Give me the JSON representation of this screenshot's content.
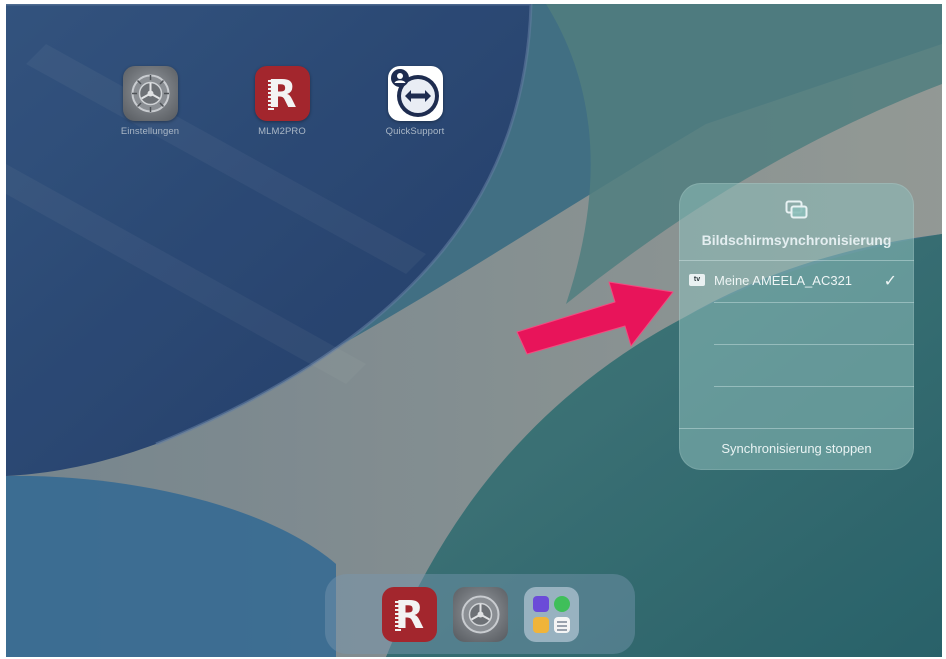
{
  "home_apps": [
    {
      "label": "Einstellungen",
      "icon": "settings-gear-icon"
    },
    {
      "label": "MLM2PRO",
      "icon": "mlm2pro-app-icon"
    },
    {
      "label": "QuickSupport",
      "icon": "quicksupport-app-icon"
    }
  ],
  "screen_mirroring": {
    "icon": "screen-mirroring-icon",
    "title": "Bildschirmsynchronisierung",
    "devices": [
      {
        "badge": "tv",
        "name": "Meine AMEELA_AC321",
        "selected": true
      }
    ],
    "stop_label": "Synchronisierung stoppen"
  },
  "dock_apps": [
    {
      "icon": "mlm2pro-app-icon"
    },
    {
      "icon": "settings-gear-icon"
    },
    {
      "icon": "app-folder-icon"
    }
  ],
  "annotation": {
    "arrow_color": "#e8145a"
  }
}
